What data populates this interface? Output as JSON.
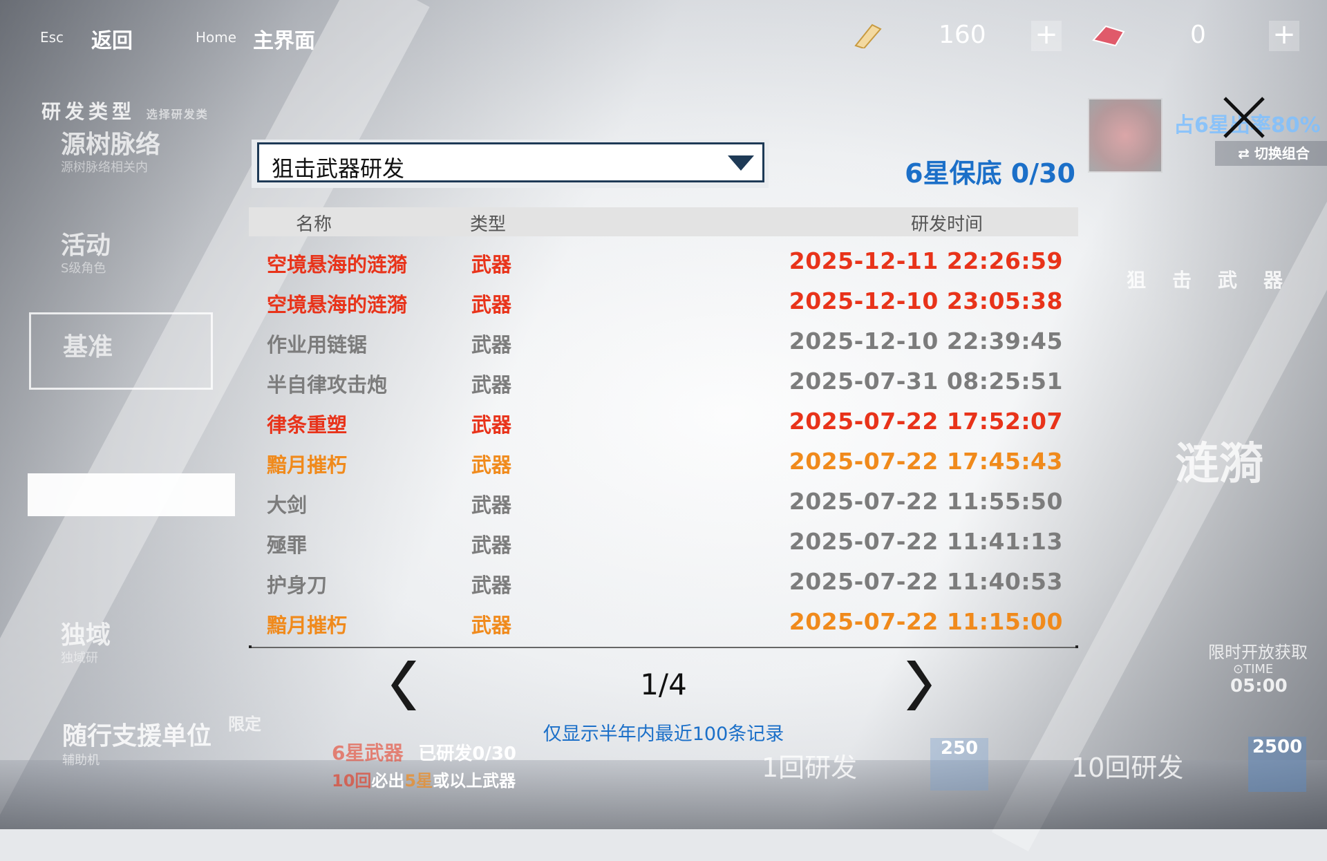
{
  "topbar": {
    "esc_key": "Esc",
    "back_label": "返回",
    "home_key": "Home",
    "home_label": "主界面",
    "currency1_value": "160",
    "currency2_value": "0",
    "plus_symbol": "+"
  },
  "left_menu": {
    "type_title": "研发类型",
    "type_hint": "选择研发类",
    "items": [
      {
        "label": "源树脉络",
        "sub": "源树脉络相关内"
      },
      {
        "label": "活动",
        "sub": "S级角色"
      },
      {
        "label": "基准",
        "sub": ""
      },
      {
        "label": "独域",
        "sub": "独域研"
      }
    ]
  },
  "right_panel": {
    "rate_text": "占6星出率80%",
    "switch_label": "⇄ 切换组合",
    "pool_title": "狙击武器",
    "big_name": "涟漪",
    "open_info": "限时开放获取",
    "time_label": "⊙TIME",
    "time_value": "05:00"
  },
  "bottom": {
    "support_label": "随行支援单位",
    "support_sub": "辅助机",
    "limit_tag": "限定",
    "six_star_label": "6星武器",
    "researched": "已研发0/30",
    "guarantee": {
      "prefix": "10回",
      "mid": "必出",
      "star": "5星",
      "suffix": "或以上武器"
    },
    "pull1_label": "1回研发",
    "pull1_cost": "250",
    "pull10_label": "10回研发",
    "pull10_cost": "2500"
  },
  "modal": {
    "dropdown_value": "狙击武器研发",
    "pity_text": "6星保底 0/30",
    "headers": {
      "name": "名称",
      "type": "类型",
      "time": "研发时间"
    },
    "rows": [
      {
        "name": "空境悬海的涟漪",
        "type": "武器",
        "time": "2025-12-11 22:26:59",
        "rarity": "red"
      },
      {
        "name": "空境悬海的涟漪",
        "type": "武器",
        "time": "2025-12-10 23:05:38",
        "rarity": "red"
      },
      {
        "name": "作业用链锯",
        "type": "武器",
        "time": "2025-12-10 22:39:45",
        "rarity": "gray"
      },
      {
        "name": "半自律攻击炮",
        "type": "武器",
        "time": "2025-07-31 08:25:51",
        "rarity": "gray"
      },
      {
        "name": "律条重塑",
        "type": "武器",
        "time": "2025-07-22 17:52:07",
        "rarity": "red"
      },
      {
        "name": "黯月摧朽",
        "type": "武器",
        "time": "2025-07-22 17:45:43",
        "rarity": "orange"
      },
      {
        "name": "大剑",
        "type": "武器",
        "time": "2025-07-22 11:55:50",
        "rarity": "gray"
      },
      {
        "name": "殛罪",
        "type": "武器",
        "time": "2025-07-22 11:41:13",
        "rarity": "gray"
      },
      {
        "name": "护身刀",
        "type": "武器",
        "time": "2025-07-22 11:40:53",
        "rarity": "gray"
      },
      {
        "name": "黯月摧朽",
        "type": "武器",
        "time": "2025-07-22 11:15:00",
        "rarity": "orange"
      }
    ],
    "page_indicator": "1/4",
    "note": "仅显示半年内最近100条记录"
  },
  "colors": {
    "red": "#e8331a",
    "orange": "#f08a1c",
    "gray": "#7c7c7c",
    "accent": "#1b6fc8",
    "dark": "#1e3a56"
  }
}
